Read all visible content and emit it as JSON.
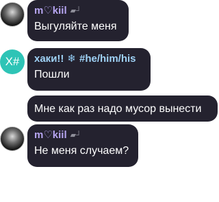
{
  "messages": [
    {
      "sender": "m♡kiil",
      "sender_icon": "gun-icon",
      "avatar": "profile-photo",
      "text": "Выгуляйте меня"
    },
    {
      "sender": "хаки!!",
      "sender_emoji": "❄",
      "sender_tag": "#he/him/his",
      "avatar_initials": "X#",
      "avatar_color": "#2ec4b6",
      "texts": [
        "Пошли",
        "Мне как раз надо мусор вынести"
      ]
    },
    {
      "sender": "m♡kiil",
      "sender_icon": "gun-icon",
      "avatar": "profile-photo",
      "text": "Не меня случаем?"
    }
  ],
  "colors": {
    "bubble": "#24222f",
    "name_kiil": "#b7a6f2",
    "name_hakki": "#9fd2f6"
  }
}
